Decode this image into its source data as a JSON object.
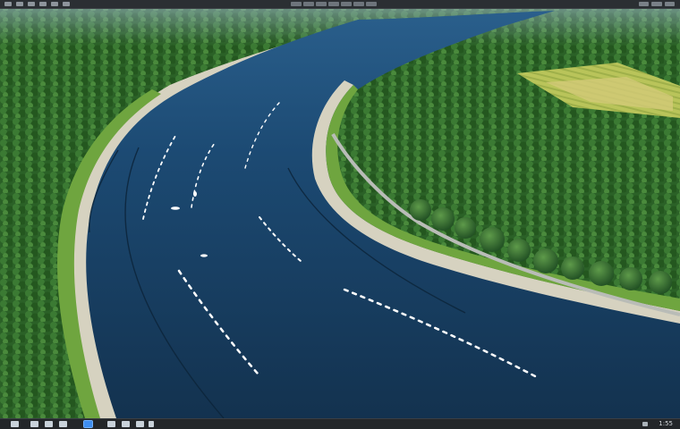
{
  "window": {
    "toolbar_buttons": [
      "menu-icon",
      "file-icon",
      "edit-icon",
      "view-icon",
      "window-icon",
      "help-icon"
    ],
    "tray_buttons": [
      "settings-icon",
      "layers-icon",
      "grid-icon"
    ]
  },
  "scene": {
    "subject": "aerial-river-landscape",
    "colors": {
      "water": "#163a5e",
      "forest": "#2f6a2a",
      "meadow": "#6fa53f",
      "sand": "#d9d4c2",
      "road": "#b7bbb8",
      "field": "#c9c36a"
    }
  },
  "taskbar": {
    "apps": [
      "start-icon",
      "search-icon",
      "files-icon",
      "browser-icon",
      "editor-icon",
      "terminal-icon",
      "image-icon",
      "settings-icon"
    ],
    "active_app": "browser-icon",
    "tray_text": "1:55"
  }
}
